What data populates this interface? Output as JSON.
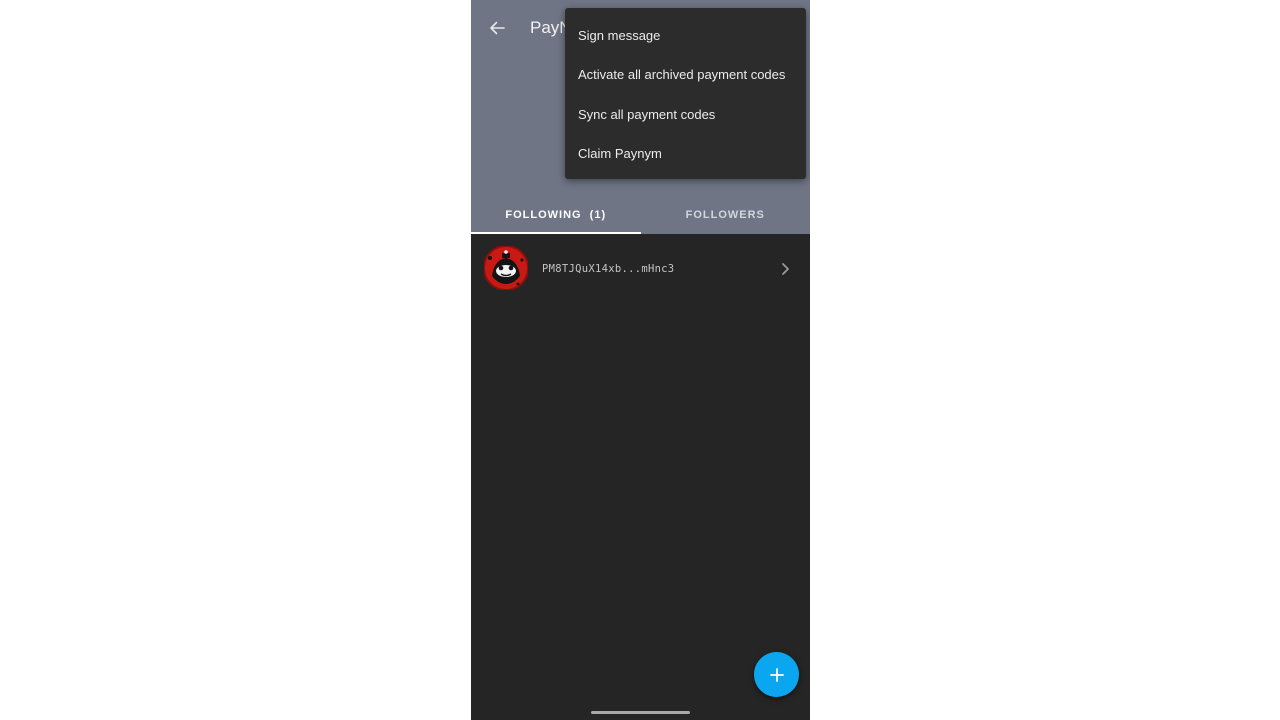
{
  "header": {
    "title": "PayN"
  },
  "tabs": [
    {
      "label": "FOLLOWING  (1)",
      "active": true
    },
    {
      "label": "FOLLOWERS",
      "active": false
    }
  ],
  "following_list": [
    {
      "code": "PM8TJQuX14xb...mHnc3",
      "avatar": "paynym-robot-avatar"
    }
  ],
  "overflow_menu": {
    "items": [
      {
        "label": "Sign message"
      },
      {
        "label": "Activate all archived payment codes"
      },
      {
        "label": "Sync all payment codes"
      },
      {
        "label": "Claim Paynym"
      }
    ]
  },
  "fab": {
    "icon": "plus-icon"
  },
  "colors": {
    "header_bg": "#6f7585",
    "body_bg": "#252525",
    "menu_bg": "#2c2c2c",
    "fab_bg": "#0aa7f0"
  }
}
